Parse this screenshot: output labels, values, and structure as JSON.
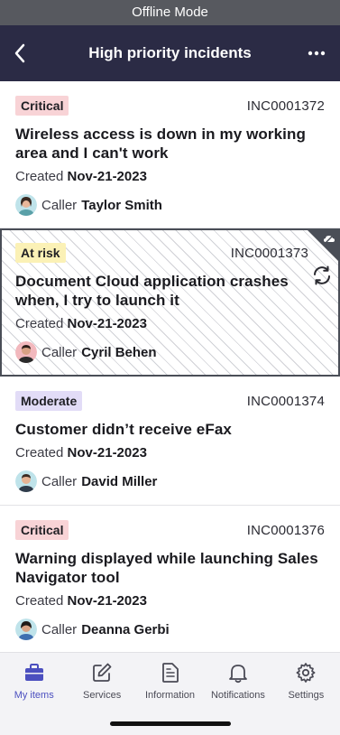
{
  "status_bar": {
    "banner": "Offline Mode"
  },
  "header": {
    "title": "High priority incidents"
  },
  "incidents": [
    {
      "priority": "Critical",
      "priority_color": "#f8d3d6",
      "number": "INC0001372",
      "title": "Wireless access is down in my working area and I can't work",
      "created_label": "Created",
      "created_date": "Nov-21-2023",
      "caller_label": "Caller",
      "caller_name": "Taylor Smith"
    },
    {
      "priority": "At risk",
      "priority_color": "#fbf1b6",
      "number": "INC0001373",
      "title": "Document Cloud application crashes when, I try to launch it",
      "created_label": "Created",
      "created_date": "Nov-21-2023",
      "caller_label": "Caller",
      "caller_name": "Cyril Behen"
    },
    {
      "priority": "Moderate",
      "priority_color": "#e2dcf7",
      "number": "INC0001374",
      "title": "Customer didn’t receive eFax",
      "created_label": "Created",
      "created_date": "Nov-21-2023",
      "caller_label": "Caller",
      "caller_name": "David Miller"
    },
    {
      "priority": "Critical",
      "priority_color": "#f8d3d6",
      "number": "INC0001376",
      "title": "Warning displayed while launching Sales Navigator tool",
      "created_label": "Created",
      "created_date": "Nov-21-2023",
      "caller_label": "Caller",
      "caller_name": "Deanna Gerbi"
    }
  ],
  "tabbar": {
    "active_color": "#4b4fbf",
    "items": [
      {
        "label": "My items",
        "icon": "briefcase-icon"
      },
      {
        "label": "Services",
        "icon": "edit-icon"
      },
      {
        "label": "Information",
        "icon": "document-icon"
      },
      {
        "label": "Notifications",
        "icon": "bell-icon"
      },
      {
        "label": "Settings",
        "icon": "gear-icon"
      }
    ]
  }
}
